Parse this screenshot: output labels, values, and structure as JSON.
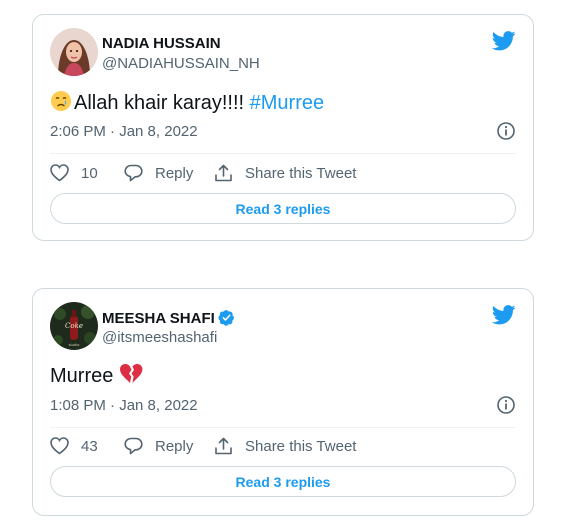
{
  "colors": {
    "accent": "#1d9bf0",
    "heart_red": "#dd2e44",
    "muted": "#536471",
    "border": "#cfd9de"
  },
  "tweets": [
    {
      "author_name": "NADIA HUSSAIN",
      "handle": "@NADIAHUSSAIN_NH",
      "verified": false,
      "text": "Allah khair karay!!!! ",
      "hashtag": "#Murree",
      "emoji": "crying-face",
      "timestamp": "2:06 PM · Jan 8, 2022",
      "likes": "10",
      "reply_label": "Reply",
      "share_label": "Share this Tweet",
      "read_replies_label": "Read 3 replies"
    },
    {
      "author_name": "MEESHA SHAFI",
      "handle": "@itsmeeshashafi",
      "verified": true,
      "text": "Murree ",
      "emoji": "broken-heart",
      "timestamp": "1:08 PM · Jan 8, 2022",
      "likes": "43",
      "reply_label": "Reply",
      "share_label": "Share this Tweet",
      "read_replies_label": "Read 3 replies"
    }
  ]
}
